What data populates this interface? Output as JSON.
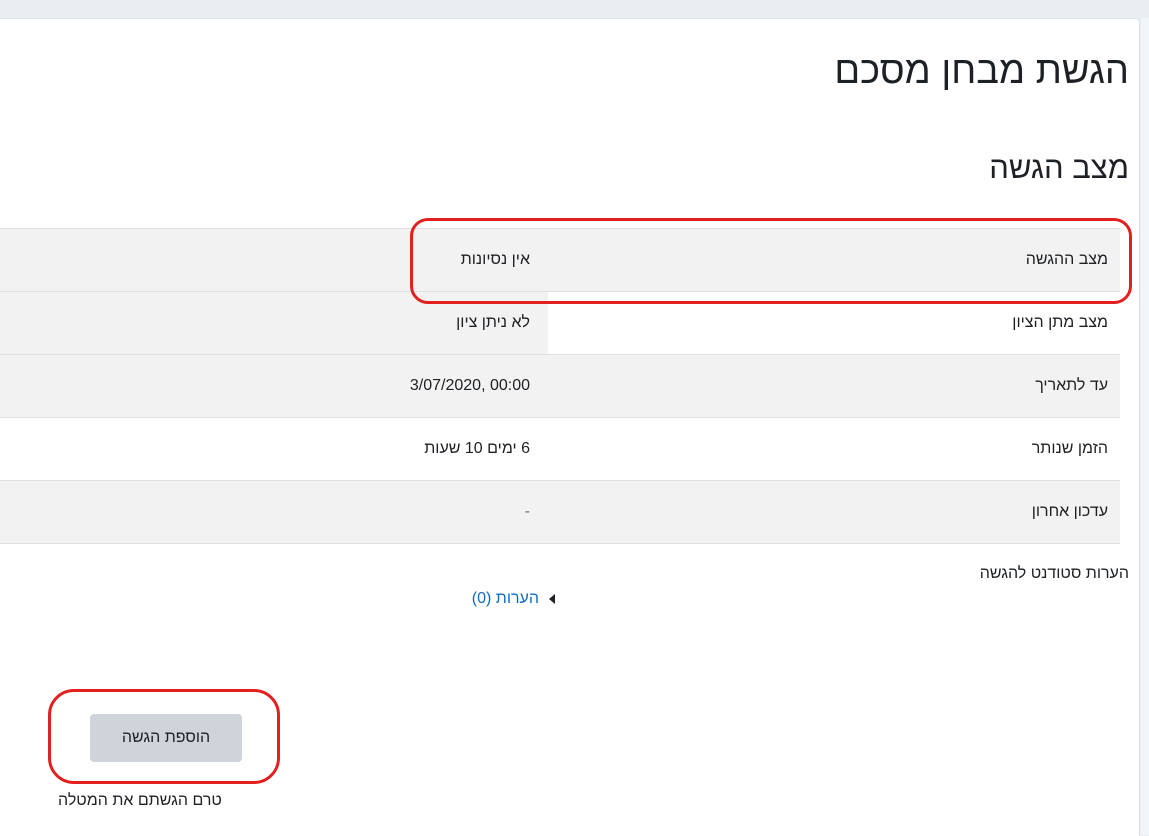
{
  "page": {
    "title": "הגשת מבחן מסכם",
    "section_title": "מצב הגשה"
  },
  "status_table": {
    "rows": [
      {
        "label": "מצב ההגשה",
        "value": "אין נסיונות"
      },
      {
        "label": "מצב מתן הציון",
        "value": "לא ניתן ציון"
      },
      {
        "label": "עד לתאריך",
        "value": "3/07/2020, 00:00"
      },
      {
        "label": "הזמן שנותר",
        "value": "6 ימים 10 שעות"
      },
      {
        "label": "עדכון אחרון",
        "value": "-"
      }
    ]
  },
  "comments": {
    "label": "הערות סטודנט להגשה",
    "toggle_text": "הערות (0)"
  },
  "submission": {
    "button_label": "הוספת הגשה",
    "note": "טרם הגשתם את המטלה"
  },
  "colors": {
    "highlight": "#e32020",
    "link": "#0f6cbf",
    "stripe": "#f2f2f2",
    "button": "#ced4da"
  }
}
